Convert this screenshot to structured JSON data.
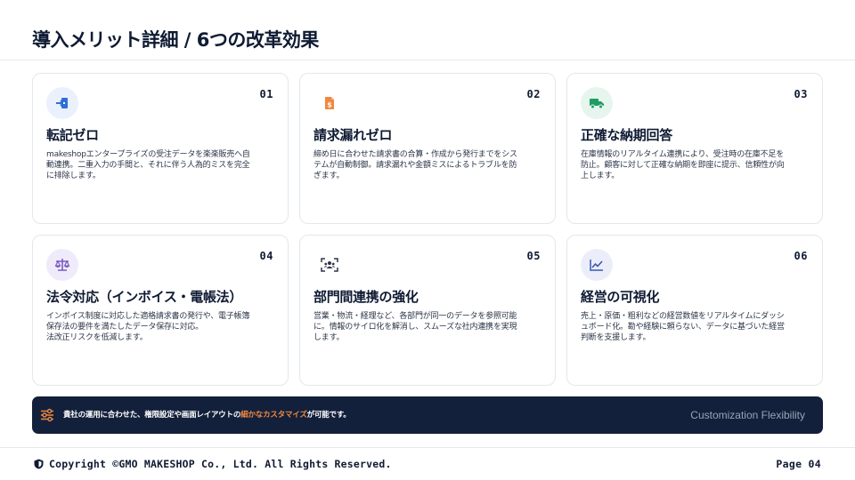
{
  "header": {
    "title": "導入メリット詳細 / 6つの改革効果"
  },
  "cards": [
    {
      "number": "01",
      "icon": "import-arrow-icon",
      "title": "転記ゼロ",
      "description": "makeshopエンタープライズの受注データを楽楽販売へ自\n動連携。二重入力の手間と、それに伴う人為的ミスを完全\nに排除します。",
      "icon_color": "#2f6fd6",
      "icon_bg": "#eaf1fc"
    },
    {
      "number": "02",
      "icon": "invoice-document-icon",
      "title": "請求漏れゼロ",
      "description": "締め日に合わせた請求書の合算・作成から発行までをシス\nテムが自動制御。請求漏れや金額ミスによるトラブルを防\nぎます。",
      "icon_color": "#f0883e",
      "icon_bg": "#ffffff"
    },
    {
      "number": "03",
      "icon": "delivery-truck-icon",
      "title": "正確な納期回答",
      "description": "在庫情報のリアルタイム連携により、受注時の在庫不足を\n防止。顧客に対して正確な納期を即座に提示、信頼性が向\n上します。",
      "icon_color": "#1f9d63",
      "icon_bg": "#e6f5ee"
    },
    {
      "number": "04",
      "icon": "balance-scale-icon",
      "title": "法令対応（インボイス・電帳法）",
      "description": "インボイス制度に対応した適格請求書の発行や、電子帳簿\n保存法の要件を満たしたデータ保存に対応。\n法改正リスクを低減します。",
      "icon_color": "#7b5cc4",
      "icon_bg": "#f0ebfa"
    },
    {
      "number": "05",
      "icon": "team-users-icon",
      "title": "部門間連携の強化",
      "description": "営業・物流・経理など、各部門が同一のデータを参照可能\nに。情報のサイロ化を解消し、スムーズな社内連携を実現\nします。",
      "icon_color": "#2b3548",
      "icon_bg": "#ffffff"
    },
    {
      "number": "06",
      "icon": "line-chart-icon",
      "title": "経営の可視化",
      "description": "売上・原価・粗利などの経営数値をリアルタイムにダッシ\nュボード化。勘や経験に頼らない、データに基づいた経営\n判断を支援します。",
      "icon_color": "#3d56b0",
      "icon_bg": "#ebeefa"
    }
  ],
  "banner": {
    "icon": "sliders-icon",
    "text_before": "貴社の運用に合わせた、権限設定や画面レイアウトの",
    "text_highlight": "細かなカスタマイズ",
    "text_after": "が可能です。",
    "text_en": "Customization Flexibility",
    "highlight_color": "#f0883e"
  },
  "footer": {
    "icon": "shield-icon",
    "copyright": "Copyright ©GMO MAKESHOP Co., Ltd. All Rights Reserved.",
    "page": "Page 04"
  }
}
